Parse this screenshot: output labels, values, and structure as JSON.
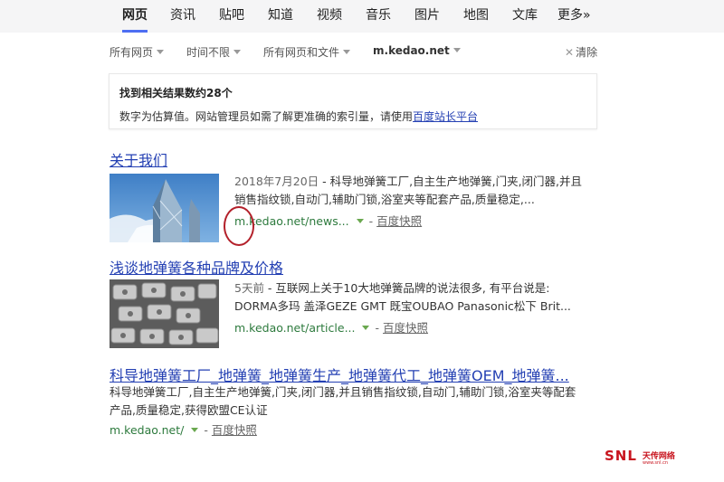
{
  "nav": {
    "tabs": [
      {
        "label": "网页",
        "active": true
      },
      {
        "label": "资讯"
      },
      {
        "label": "贴吧"
      },
      {
        "label": "知道"
      },
      {
        "label": "视频"
      },
      {
        "label": "音乐"
      },
      {
        "label": "图片"
      },
      {
        "label": "地图"
      },
      {
        "label": "文库"
      },
      {
        "label": "更多»"
      }
    ]
  },
  "filters": {
    "site_scope": "所有网页",
    "time": "时间不限",
    "file_type": "所有网页和文件",
    "domain": "m.kedao.net",
    "clear": "清除"
  },
  "notice": {
    "count_text": "找到相关结果数约28个",
    "desc_text": "数字为估算值。网站管理员如需了解更准确的索引量，请使用",
    "link_text": "百度站长平台"
  },
  "results": [
    {
      "title": "关于我们",
      "date": "2018年7月20日",
      "abstract_1": "科导地弹簧工厂,自主生产地弹簧,门夹,闭门器,并且",
      "abstract_2": "销售指纹锁,自动门,辅助门锁,浴室夹等配套产品,质量稳定,...",
      "url": "m.kedao.net/news...",
      "cache": "百度快照",
      "thumbnail": "building-photo"
    },
    {
      "title": "浅谈地弹簧各种品牌及价格",
      "date": "5天前",
      "abstract_1": "互联网上关于10大地弹簧品牌的说法很多, 有平台说是:",
      "abstract_2": "DORMA多玛 盖泽GEZE GMT 既宝OUBAO Panasonic松下 Brit...",
      "url": "m.kedao.net/article...",
      "cache": "百度快照",
      "thumbnail": "hinge-parts-photo"
    },
    {
      "title": "科导地弹簧工厂_地弹簧_地弹簧生产_地弹簧代工_地弹簧OEM_地弹簧...",
      "abstract_1": "科导地弹簧工厂,自主生产地弹簧,门夹,闭门器,并且销售指纹锁,自动门,辅助门锁,浴室夹等配套",
      "abstract_2": "产品,质量稳定,获得欧盟CE认证",
      "url": "m.kedao.net/",
      "cache": "百度快照"
    }
  ],
  "date_sep": " - ",
  "url_sep": "-",
  "watermark": {
    "logo": "SNL",
    "cn": "天传网络",
    "web": "www.snl.cn"
  }
}
